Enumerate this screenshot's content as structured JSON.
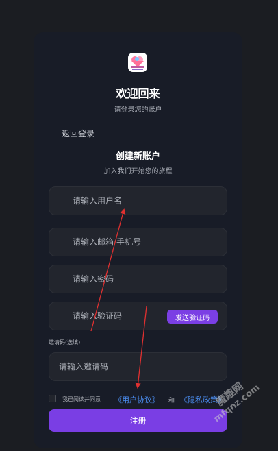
{
  "header": {
    "welcome_title": "欢迎回来",
    "welcome_subtitle": "请登录您的账户"
  },
  "nav": {
    "back_label": "返回登录"
  },
  "register": {
    "title": "创建新账户",
    "subtitle": "加入我们开始您的旅程"
  },
  "form": {
    "username_placeholder": "请输入用户名",
    "contact_placeholder": "请输入邮箱/手机号",
    "password_placeholder": "请输入密码",
    "code_placeholder": "请输入验证码",
    "send_code_label": "发送验证码",
    "invite_label": "邀请码(选填)",
    "invite_placeholder": "请输入邀请码"
  },
  "agreement": {
    "prefix": "我已阅读并同意",
    "user_agreement": "《用户协议》",
    "and": "和",
    "privacy_policy": "《隐私政策》"
  },
  "submit_label": "注册",
  "watermark": {
    "cn": "魔趣网",
    "en": "mfqnz.com"
  },
  "colors": {
    "accent": "#7a3ee4",
    "link": "#4b8df0",
    "card_bg": "#181c27",
    "annotation": "#e03030"
  },
  "icons": {
    "logo": "app-logo-icon"
  }
}
